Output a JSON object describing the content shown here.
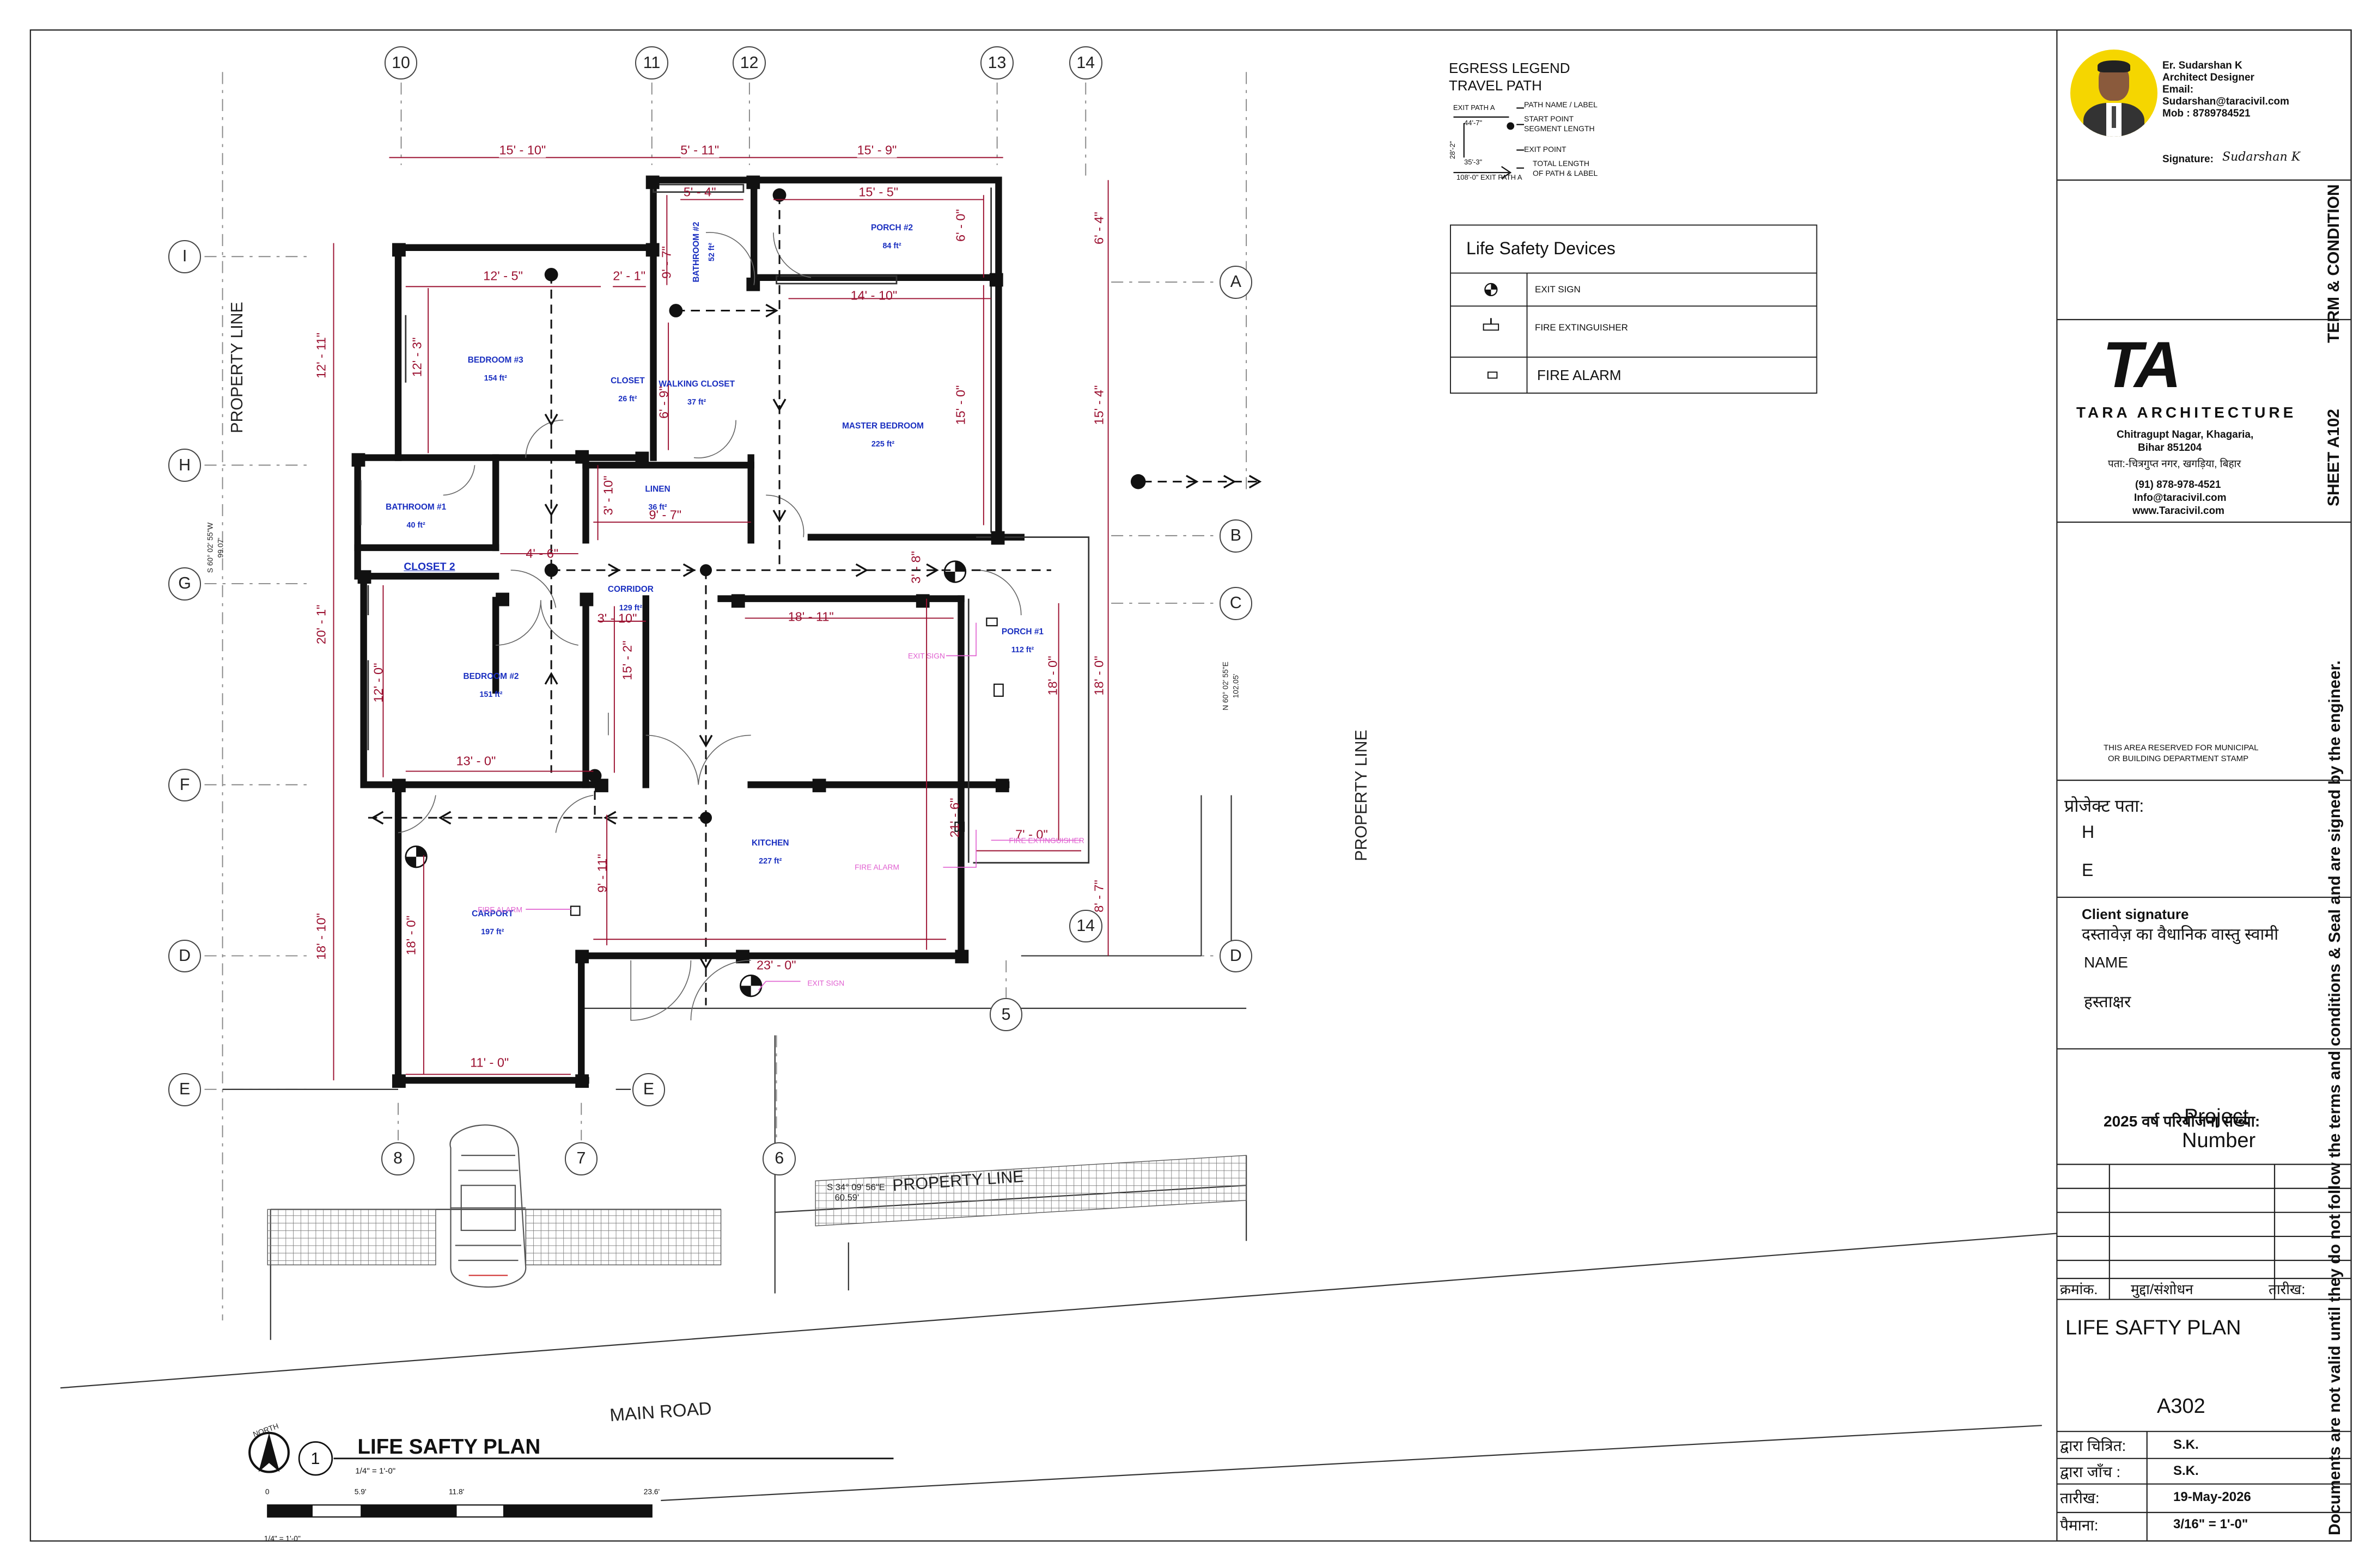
{
  "plan": {
    "grid_top": [
      "10",
      "11",
      "12",
      "13",
      "14"
    ],
    "grid_bottom": [
      "8",
      "7",
      "6",
      "5"
    ],
    "grid_bottom_14": "14",
    "grid_left": [
      "I",
      "H",
      "G",
      "F",
      "D",
      "E"
    ],
    "grid_right": [
      "A",
      "B",
      "C",
      "D"
    ],
    "grid_e_right": "E",
    "top_dims": [
      "15' - 10\"",
      "5' - 11\"",
      "15' - 9\""
    ],
    "dims": {
      "d_5_4": "5' - 4\"",
      "d_15_5": "15' - 5\"",
      "d_6_0a": "6' - 0\"",
      "d_12_5": "12' - 5\"",
      "d_2_1": "2' - 1\"",
      "d_9_7v": "9' - 7\"",
      "d_14_10": "14' - 10\"",
      "d_12_3": "12' - 3\"",
      "d_6_9": "6' - 9\"",
      "d_15_0": "15' - 0\"",
      "d_4_6": "4' - 6\"",
      "d_3_10v": "3' - 10\"",
      "d_9_7": "9' - 7\"",
      "d_3_10": "3' - 10\"",
      "d_3_8": "3' - 8\"",
      "d_18_11": "18' - 11\"",
      "d_12_0": "12' - 0\"",
      "d_15_2": "15' - 2\"",
      "d_13_0": "13' - 0\"",
      "d_21_6": "21' - 6\"",
      "d_18_0r": "18' - 0\"",
      "d_7_0": "7' - 0\"",
      "d_9_11": "9' - 11\"",
      "d_18_0c": "18' - 0\"",
      "d_23_0": "23' - 0\"",
      "d_11_0": "11' - 0\"",
      "d_left_12_11": "12' - 11\"",
      "d_left_20_1": "20' - 1\"",
      "d_left_18_10": "18' - 10\"",
      "d_right_6_4": "6' - 4\"",
      "d_right_15_4": "15' - 4\"",
      "d_right_18_0": "18' - 0\"",
      "d_right_8_7": "8' - 7\""
    },
    "rooms": [
      {
        "name": "PORCH #2",
        "area": "84 ft²"
      },
      {
        "name": "BATHROOM #2",
        "area": "52 ft²"
      },
      {
        "name": "BEDROOM #3",
        "area": "154 ft²"
      },
      {
        "name": "CLOSET",
        "area": "26 ft²"
      },
      {
        "name": "WALKING CLOSET",
        "area": "37 ft²"
      },
      {
        "name": "MASTER BEDROOM",
        "area": "225 ft²"
      },
      {
        "name": "BATHROOM #1",
        "area": "40 ft²"
      },
      {
        "name": "LINEN",
        "area": "36 ft²"
      },
      {
        "name": "CORRIDOR",
        "area": "129 ft²"
      },
      {
        "name": "PORCH #1",
        "area": "112 ft²"
      },
      {
        "name": "BEDROOM #2",
        "area": "151 ft²"
      },
      {
        "name": "KITCHEN",
        "area": "227 ft²"
      },
      {
        "name": "CARPORT",
        "area": "197 ft²"
      }
    ],
    "closet2": "CLOSET 2",
    "tags": {
      "exit_sign_1": "EXIT SIGN",
      "fire_alarm_1": "FIRE ALARM",
      "fire_ext": "FIRE EXTINGUISHER",
      "fire_alarm_2": "FIRE ALARM",
      "exit_sign_2": "EXIT SIGN"
    },
    "property_line": "PROPERTY LINE",
    "bearing_left": "S 60° 02' 55\"W",
    "bearing_left_len": "99.07'",
    "bearing_right": "N 60° 02' 55\"E",
    "bearing_right_len": "102.05'",
    "bearing_bottom": "S 34° 09' 56\"E",
    "bearing_bottom_len": "60.59'",
    "main_road": "MAIN ROAD",
    "north": "NORTH",
    "view_number": "1",
    "view_title": "LIFE SAFTY PLAN",
    "view_scale": "1/4\" = 1'-0\"",
    "scale_ticks": [
      "0",
      "5.9'",
      "11.8'",
      "23.6'"
    ],
    "scale_note": "1/4\" = 1'-0\""
  },
  "legend": {
    "title_1": "EGRESS LEGEND",
    "title_2": "TRAVEL PATH",
    "exit_path_a": "EXIT PATH A",
    "seg_1": "44'-7\"",
    "seg_2": "28'-2\"",
    "seg_3": "35'-3\"",
    "total": "108'-0\" EXIT PATH A",
    "k_path_name": "PATH NAME / LABEL",
    "k_start": "START POINT",
    "k_segment": "SEGMENT LENGTH",
    "k_exit": "EXIT POINT",
    "k_total_1": "TOTAL LENGTH",
    "k_total_2": "OF PATH & LABEL"
  },
  "devices": {
    "title": "Life Safety Devices",
    "items": [
      "EXIT SIGN",
      "FIRE EXTINGUISHER",
      "FIRE ALARM"
    ]
  },
  "titleblock": {
    "engineer_name": "Er. Sudarshan K",
    "engineer_role": "Architect Designer",
    "email_label": "Email:",
    "email": "Sudarshan@taracivil.com",
    "mob": "Mob : 8789784521",
    "signature_label": "Signature:",
    "signature": "Sudarshan K",
    "logo_mark": "TA",
    "firm": "TARA ARCHITECTURE",
    "addr_1": "Chitragupt Nagar, Khagaria,",
    "addr_2": "Bihar 851204",
    "addr_hi": "पता:-चित्रगुप्त नगर, खगड़िया, बिहार",
    "phone": "(91) 878-978-4521",
    "email_info": "Info@taracivil.com",
    "website": "www.Taracivil.com",
    "stamp_1": "THIS AREA RESERVED FOR MUNICIPAL",
    "stamp_2": "OR BUILDING DEPARTMENT STAMP",
    "project_address_label": "प्रोजेक्ट पता:",
    "addr_h": "H",
    "addr_e": "E",
    "client_sig": "Client signature",
    "owner_label": "दस्तावेज़ का वैधानिक वास्तु स्वामी",
    "name_label": "NAME",
    "sign_label": "हस्ताक्षर",
    "project_number_label": "2025 वर्ष परियोजना संख्या:",
    "project_number_1": "Project",
    "project_number_2": "Number",
    "rev_cols": [
      "क्रमांक.",
      "मुद्दा/संशोधन",
      "तारीख:"
    ],
    "sheet_title": "LIFE SAFTY PLAN",
    "sheet_number": "A302",
    "drawn_label": "द्वारा चित्रित:",
    "drawn": "S.K.",
    "checked_label": "द्वारा जाँच :",
    "checked": "S.K.",
    "date_label": "तारीख:",
    "date": "19-May-2026",
    "scale_label": "पैमाना:",
    "scale": "3/16\" = 1'-0\"",
    "side_1": "TERM & CONDITION",
    "side_2": "SHEET A102",
    "side_3": "Documents are not valid until they do not follow the terms and conditions & Seal and are signed by the engineer."
  },
  "colors": {
    "dimension": "#9b1030",
    "room_label": "#1a2fc0",
    "device_tag": "#e060d0",
    "wall": "#111111",
    "logo_bg": "#f5d600"
  }
}
